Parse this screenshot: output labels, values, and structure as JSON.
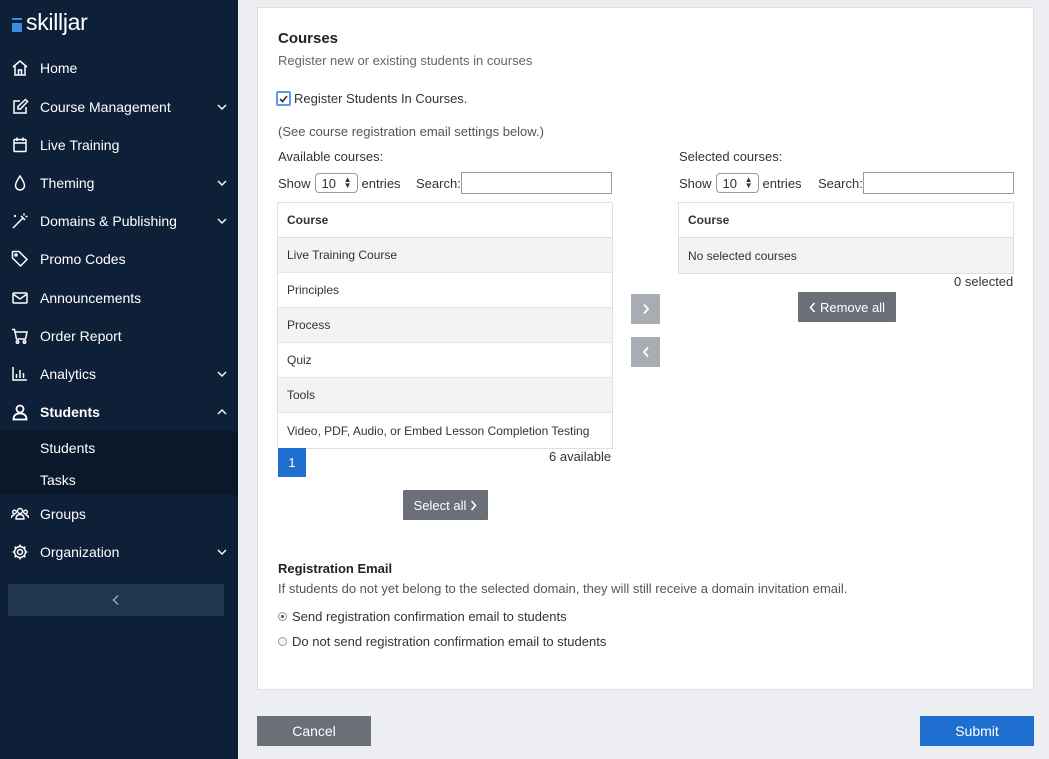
{
  "brand": {
    "name": "skilljar",
    "accent": "#3b8de0"
  },
  "sidebar": {
    "items": [
      {
        "label": "Home",
        "icon": "home-icon"
      },
      {
        "label": "Course Management",
        "icon": "edit-icon"
      },
      {
        "label": "Live Training",
        "icon": "calendar-icon"
      },
      {
        "label": "Theming",
        "icon": "drop-icon"
      },
      {
        "label": "Domains & Publishing",
        "icon": "wand-icon"
      },
      {
        "label": "Promo Codes",
        "icon": "tag-icon"
      },
      {
        "label": "Announcements",
        "icon": "envelope-icon"
      },
      {
        "label": "Order Report",
        "icon": "cart-icon"
      },
      {
        "label": "Analytics",
        "icon": "bar-chart-icon"
      },
      {
        "label": "Students",
        "icon": "user-icon"
      },
      {
        "label": "Groups",
        "icon": "users-icon"
      },
      {
        "label": "Organization",
        "icon": "gear-icon"
      }
    ],
    "sub_items": [
      "Students",
      "Tasks"
    ]
  },
  "courses": {
    "title": "Courses",
    "subtitle": "Register new or existing students in courses",
    "register_label": "Register Students In Courses.",
    "register_checked": true,
    "note": "(See course registration email settings below.)",
    "available": {
      "title": "Available courses:",
      "show": "Show",
      "entries_value": "10",
      "entries": "entries",
      "search_label": "Search:",
      "search_value": "",
      "column": "Course",
      "rows": [
        "Live Training Course",
        "Principles",
        "Process",
        "Quiz",
        "Tools",
        "Video, PDF, Audio, or Embed Lesson Completion Testing"
      ],
      "page": "1",
      "count": "6 available",
      "select_all": "Select all"
    },
    "selected": {
      "title": "Selected courses:",
      "show": "Show",
      "entries_value": "10",
      "entries": "entries",
      "search_label": "Search:",
      "search_value": "",
      "column": "Course",
      "empty": "No selected courses",
      "count": "0 selected",
      "remove_all": "Remove all"
    }
  },
  "registration_email": {
    "title": "Registration Email",
    "description": "If students do not yet belong to the selected domain, they will still receive a domain invitation email.",
    "options": [
      {
        "label": "Send registration confirmation email to students",
        "selected": true
      },
      {
        "label": "Do not send registration confirmation email to students",
        "selected": false
      }
    ]
  },
  "actions": {
    "cancel": "Cancel",
    "submit": "Submit"
  }
}
